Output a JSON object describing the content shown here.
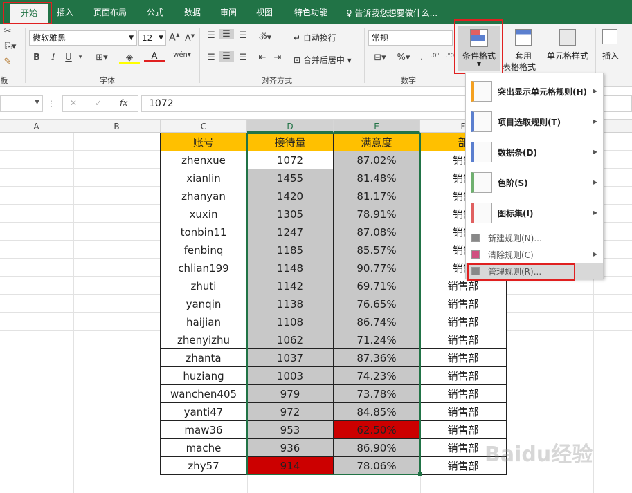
{
  "tabs": [
    "开始",
    "插入",
    "页面布局",
    "公式",
    "数据",
    "审阅",
    "视图",
    "特色功能"
  ],
  "tell_me": "告诉我您想要做什么...",
  "ribbon": {
    "font_name": "微软雅黑",
    "font_size": "12",
    "wrap_text": "自动换行",
    "merge_center": "合并后居中",
    "number_format": "常规",
    "cond_format": "条件格式",
    "table_format_1": "套用",
    "table_format_2": "表格格式",
    "cell_styles": "单元格样式",
    "insert": "插入",
    "group_font": "字体",
    "group_align": "对齐方式",
    "group_number": "数字",
    "group_clip": "板"
  },
  "formula": {
    "fx": "fx",
    "value": "1072"
  },
  "columns": [
    "A",
    "B",
    "C",
    "D",
    "E",
    "F"
  ],
  "headers": {
    "c": "账号",
    "d": "接待量",
    "e": "满意度",
    "f": "部"
  },
  "rows": [
    {
      "c": "zhenxue",
      "d": "1072",
      "e": "87.02%",
      "f": "销售"
    },
    {
      "c": "xianlin",
      "d": "1455",
      "e": "81.48%",
      "f": "销售"
    },
    {
      "c": "zhanyan",
      "d": "1420",
      "e": "81.17%",
      "f": "销售"
    },
    {
      "c": "xuxin",
      "d": "1305",
      "e": "78.91%",
      "f": "销售"
    },
    {
      "c": "tonbin11",
      "d": "1247",
      "e": "87.08%",
      "f": "销售"
    },
    {
      "c": "fenbinq",
      "d": "1185",
      "e": "85.57%",
      "f": "销售"
    },
    {
      "c": "chlian199",
      "d": "1148",
      "e": "90.77%",
      "f": "销售"
    },
    {
      "c": "zhuti",
      "d": "1142",
      "e": "69.71%",
      "f": "销售部"
    },
    {
      "c": "yanqin",
      "d": "1138",
      "e": "76.65%",
      "f": "销售部"
    },
    {
      "c": "haijian",
      "d": "1108",
      "e": "86.74%",
      "f": "销售部"
    },
    {
      "c": "zhenyizhu",
      "d": "1062",
      "e": "71.24%",
      "f": "销售部"
    },
    {
      "c": "zhanta",
      "d": "1037",
      "e": "87.36%",
      "f": "销售部"
    },
    {
      "c": "huziang",
      "d": "1003",
      "e": "74.23%",
      "f": "销售部"
    },
    {
      "c": "wanchen405",
      "d": "979",
      "e": "73.78%",
      "f": "销售部"
    },
    {
      "c": "yanti47",
      "d": "972",
      "e": "84.85%",
      "f": "销售部"
    },
    {
      "c": "maw36",
      "d": "953",
      "e": "62.50%",
      "f": "销售部"
    },
    {
      "c": "mache",
      "d": "936",
      "e": "86.90%",
      "f": "销售部"
    },
    {
      "c": "zhy57",
      "d": "914",
      "e": "78.06%",
      "f": "销售部"
    }
  ],
  "menu": [
    {
      "label": "突出显示单元格规则(H)",
      "arrow": "▸"
    },
    {
      "label": "项目选取规则(T)",
      "arrow": "▸"
    },
    {
      "label": "数据条(D)",
      "arrow": "▸"
    },
    {
      "label": "色阶(S)",
      "arrow": "▸"
    },
    {
      "label": "图标集(I)",
      "arrow": "▸"
    },
    {
      "label": "新建规则(N)...",
      "arrow": ""
    },
    {
      "label": "清除规则(C)",
      "arrow": "▸"
    },
    {
      "label": "管理规则(R)...",
      "arrow": ""
    }
  ],
  "colors": {
    "green": "#217346",
    "header_fill": "#ffc000",
    "gray_fill": "#c8c8c8",
    "red_fill": "#cc0000",
    "callout": "#e02020"
  },
  "watermark": "Baidu经验"
}
